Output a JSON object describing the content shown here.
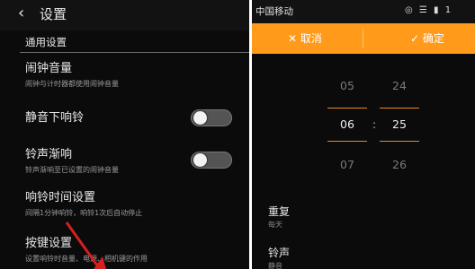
{
  "left": {
    "title": "设置",
    "section": "通用设置",
    "items": [
      {
        "title": "闹钟音量",
        "subtitle": "闹钟与计时器都使用闹钟音量"
      },
      {
        "title": "静音下响铃",
        "subtitle": ""
      },
      {
        "title": "铃声渐响",
        "subtitle": "铃声渐响至已设置的闹钟音量"
      },
      {
        "title": "响铃时间设置",
        "subtitle": "间隔1分钟响铃，响铃1次后自动停止"
      },
      {
        "title": "按键设置",
        "subtitle": "设置响铃时音量、电源、相机键的作用"
      }
    ]
  },
  "right": {
    "carrier": "中国移动",
    "status_icons": "◎ ☰ ▮ 1",
    "cancel_label": "✕  取消",
    "ok_label": "✓  确定",
    "hours": [
      "05",
      "06",
      "07"
    ],
    "minutes": [
      "24",
      "25",
      "26"
    ],
    "separator": ":",
    "repeat": {
      "title": "重复",
      "subtitle": "每天"
    },
    "ringtone": {
      "title": "铃声",
      "subtitle": "静音"
    }
  },
  "colors": {
    "accent": "#ff9a1b",
    "background": "#0b0b0b",
    "arrow": "#d42020"
  }
}
